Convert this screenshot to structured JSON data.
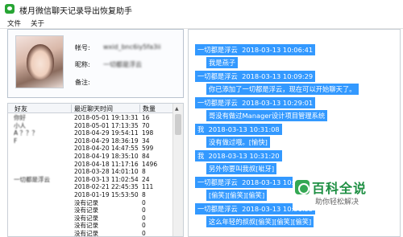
{
  "window": {
    "title": "楼月微信聊天记录导出恢复助手",
    "icon": "wechat-icon"
  },
  "menu": [
    {
      "label": "文件"
    },
    {
      "label": "关于"
    }
  ],
  "profile": {
    "account_label": "帐号:",
    "account_value": "wxid_bnc6iy5fa3ii",
    "nickname_label": "昵称:",
    "nickname_value": "一切都是浮云",
    "remark_label": "备注:",
    "remark_value": ""
  },
  "friends": {
    "headers": {
      "name": "好友",
      "time": "最近聊天时间",
      "count": "数量"
    },
    "rows": [
      {
        "name": "你好",
        "time": "2018-05-01 19:13:31",
        "count": "16"
      },
      {
        "name": "小人",
        "time": "2018-05-01 17:13:35",
        "count": "70"
      },
      {
        "name": "A ？？？",
        "time": "2018-04-29 19:54:11",
        "count": "198"
      },
      {
        "name": "F",
        "time": "2018-04-29 18:36:19",
        "count": "34"
      },
      {
        "name": "",
        "time": "2018-04-20 14:47:55",
        "count": "599"
      },
      {
        "name": "",
        "time": "2018-04-19 18:35:10",
        "count": "84"
      },
      {
        "name": "",
        "time": "2018-04-18 11:17:16",
        "count": "1496"
      },
      {
        "name": "",
        "time": "2018-03-28 14:01:10",
        "count": "8"
      },
      {
        "name": "一切都是浮云",
        "time": "2018-03-13 11:02:54",
        "count": "24"
      },
      {
        "name": "",
        "time": "2018-02-21 22:45:35",
        "count": "111"
      },
      {
        "name": "",
        "time": "2018-01-19 15:53:50",
        "count": "8"
      },
      {
        "name": "",
        "time": "没有记录",
        "count": "0"
      },
      {
        "name": "",
        "time": "没有记录",
        "count": "0"
      },
      {
        "name": "",
        "time": "没有记录",
        "count": "0"
      },
      {
        "name": "",
        "time": "没有记录",
        "count": "0"
      },
      {
        "name": "",
        "time": "没有记录",
        "count": "0"
      }
    ]
  },
  "chat": [
    {
      "sender": "一切都是浮云",
      "time": "2018-03-13 10:06:41",
      "content": "我是燕子"
    },
    {
      "sender": "一切都是浮云",
      "time": "2018-03-13 10:09:29",
      "content": "你已添加了一切都是浮云，现在可以开始聊天了。"
    },
    {
      "sender": "一切都是浮云",
      "time": "2018-03-13 10:29:01",
      "content": "哥没有做过Manager设计项目管理系统"
    },
    {
      "sender": "我",
      "time": "2018-03-13 10:31:08",
      "content": "没有做过哦。[愉快]"
    },
    {
      "sender": "我",
      "time": "2018-03-13 10:31:20",
      "content": "另外你要叫我叔[呲牙]"
    },
    {
      "sender": "一切都是浮云",
      "time": "2018-03-13 10:31:48",
      "content": "[偷笑][偷笑][偷笑]"
    },
    {
      "sender": "一切都是浮云",
      "time": "2018-03-13 10:31:55",
      "content": "这么年轻的叔叔[偷笑][偷笑][偷笑]"
    }
  ],
  "watermark": {
    "title": "百科全说",
    "subtitle": "助你轻松解决"
  }
}
